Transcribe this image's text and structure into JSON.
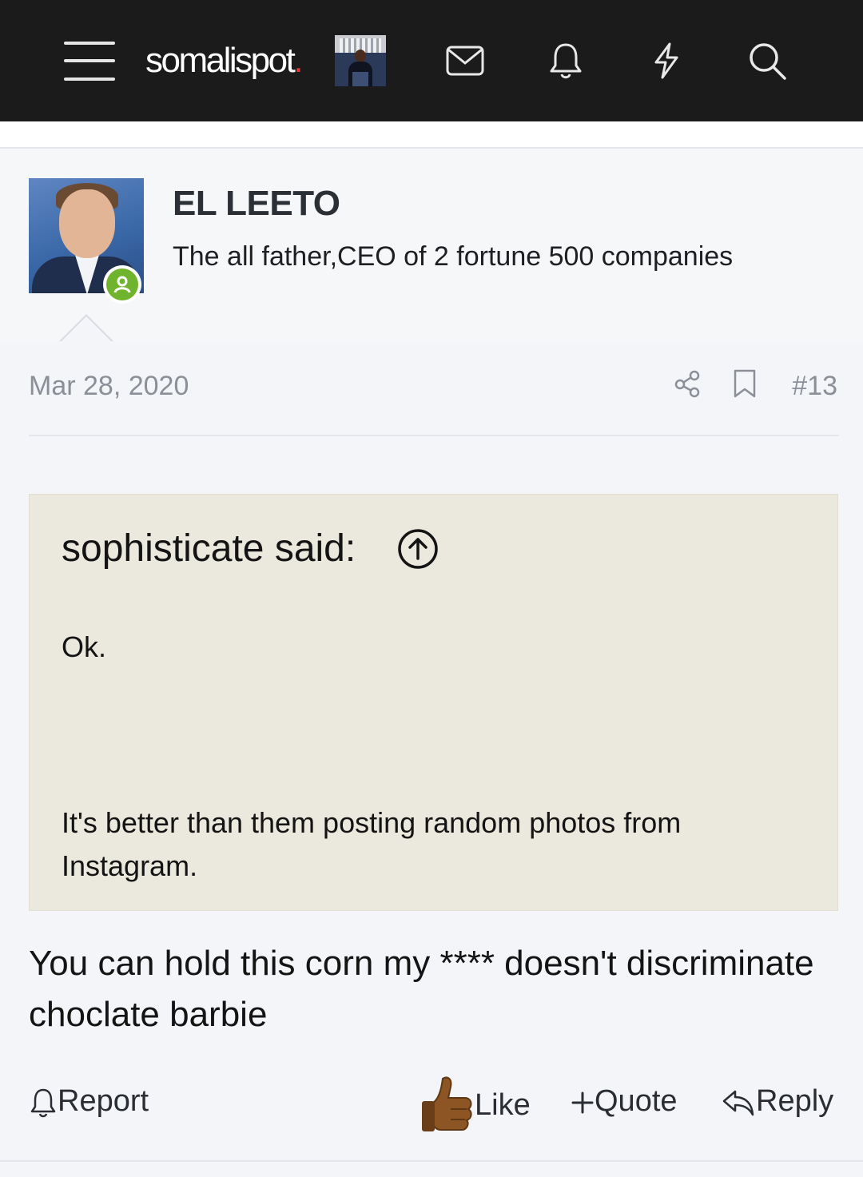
{
  "header": {
    "logo_text": "somalispot",
    "logo_dot": ".",
    "icons": [
      "menu-icon",
      "envelope-icon",
      "bell-icon",
      "lightning-icon",
      "search-icon"
    ]
  },
  "post": {
    "author": {
      "username": "EL LEETO",
      "user_title": "The all father,CEO of 2 fortune 500 companies",
      "online_status_icon": "user-online-icon"
    },
    "date": "Mar 28, 2020",
    "post_number": "#13",
    "quote": {
      "attribution": "sophisticate said:",
      "line1": "Ok.",
      "line2": "It's better than them posting random photos from Instagram."
    },
    "message": "You can hold this corn my **** doesn't discriminate choclate barbie",
    "actions": {
      "report": "Report",
      "like": "Like",
      "quote": "Quote",
      "reply": "Reply"
    }
  },
  "colors": {
    "topbar_bg": "#1b1b1b",
    "quote_bg": "#ebe9de",
    "online_green": "#6fb42c",
    "meta_gray": "#8a8f98"
  }
}
